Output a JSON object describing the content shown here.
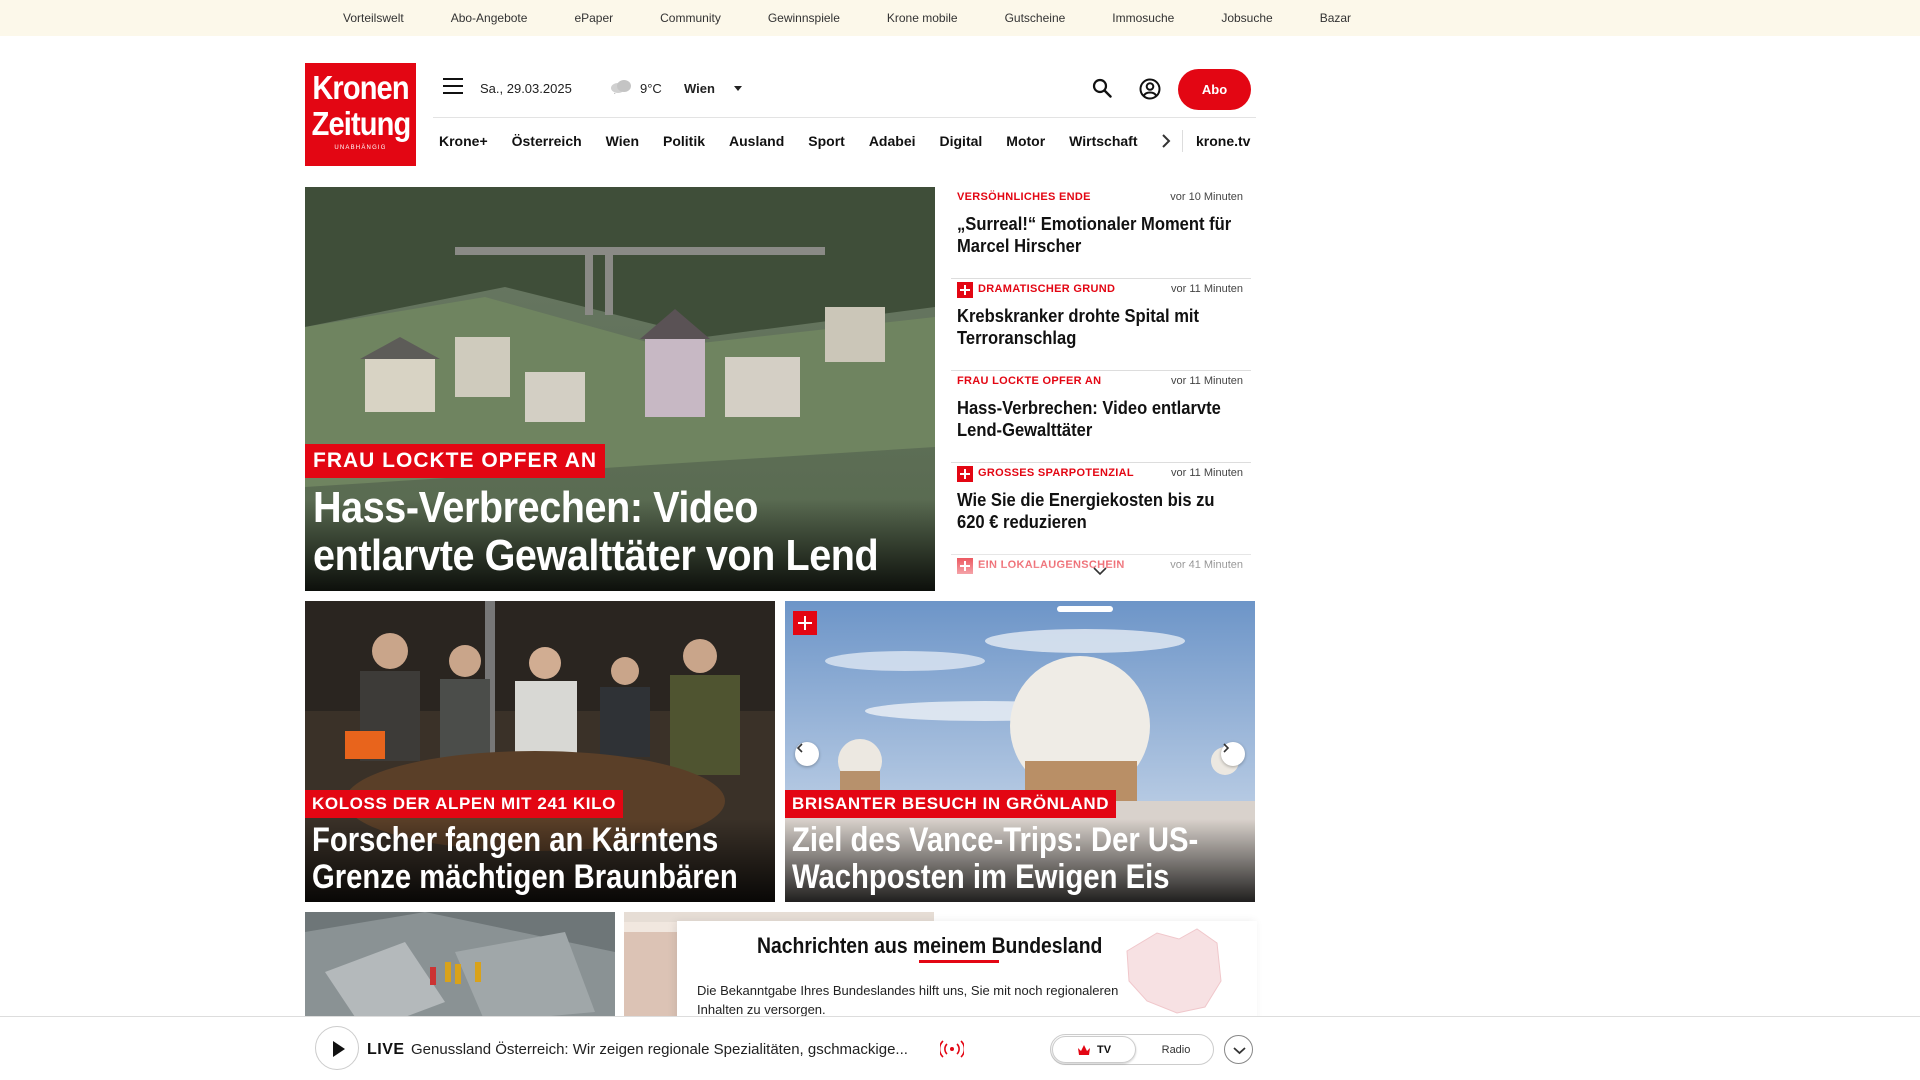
{
  "utility_nav": [
    "Vorteilswelt",
    "Abo-Angebote",
    "ePaper",
    "Community",
    "Gewinnspiele",
    "Krone mobile",
    "Gutscheine",
    "Immosuche",
    "Jobsuche",
    "Bazar"
  ],
  "logo": {
    "line1": "Kronen",
    "line2": "Zeitung",
    "tagline": "UNABHÄNGIG"
  },
  "header": {
    "date": "Sa., 29.03.2025",
    "weather_icon": "cloud-icon",
    "temperature": "9°C",
    "city": "Wien",
    "abo_label": "Abo"
  },
  "main_nav": {
    "items": [
      "Krone+",
      "Österreich",
      "Wien",
      "Politik",
      "Ausland",
      "Sport",
      "Adabei",
      "Digital",
      "Motor",
      "Wirtschaft",
      "Wissenschaft"
    ],
    "kronetv": "krone.tv"
  },
  "hero": {
    "kicker": "FRAU LOCKTE OPFER AN",
    "headline": "Hass-Verbrechen: Video entlarvte Gewalttäter von Lend"
  },
  "ticker": [
    {
      "kicker": "VERSÖHNLICHES ENDE",
      "plus": false,
      "time": "vor 10 Minuten",
      "title": "„Surreal!“ Emotionaler Moment für Marcel Hirscher"
    },
    {
      "kicker": "DRAMATISCHER GRUND",
      "plus": true,
      "time": "vor 11 Minuten",
      "title": "Krebskranker drohte Spital mit Terroranschlag"
    },
    {
      "kicker": "FRAU LOCKTE OPFER AN",
      "plus": false,
      "time": "vor 11 Minuten",
      "title": "Hass-Verbrechen: Video entlarvte Lend-Gewalttäter"
    },
    {
      "kicker": "GROSSES SPARPOTENZIAL",
      "plus": true,
      "time": "vor 11 Minuten",
      "title": "Wie Sie die Energiekosten bis zu 620 € reduzieren"
    },
    {
      "kicker": "EIN LOKALAUGENSCHEIN",
      "plus": true,
      "time": "vor 41 Minuten",
      "title": ""
    }
  ],
  "teasers": [
    {
      "kicker": "KOLOSS DER ALPEN MIT 241 KILO",
      "headline": "Forscher fangen an Kärntens Grenze mächtigen Braunbären"
    },
    {
      "kicker": "BRISANTER BESUCH IN GRÖNLAND",
      "headline": "Ziel des Vance-Trips: Der US-Wachposten im Ewigen Eis"
    }
  ],
  "region": {
    "title_pre": "Nachrichten aus ",
    "title_mid": "meinem",
    "title_post": " Bundesland",
    "text": "Die Bekanntgabe Ihres Bundeslandes hilft uns, Sie mit noch regionaleren Inhalten zu versorgen."
  },
  "livebar": {
    "live_label": "LIVE",
    "text": "Genussland Österreich: Wir zeigen regionale Spezialitäten, gschmackige...",
    "tv_label": "TV",
    "radio_label": "Radio"
  },
  "colors": {
    "brand_red": "#e30613",
    "utility_bg": "#fcf8ea"
  }
}
